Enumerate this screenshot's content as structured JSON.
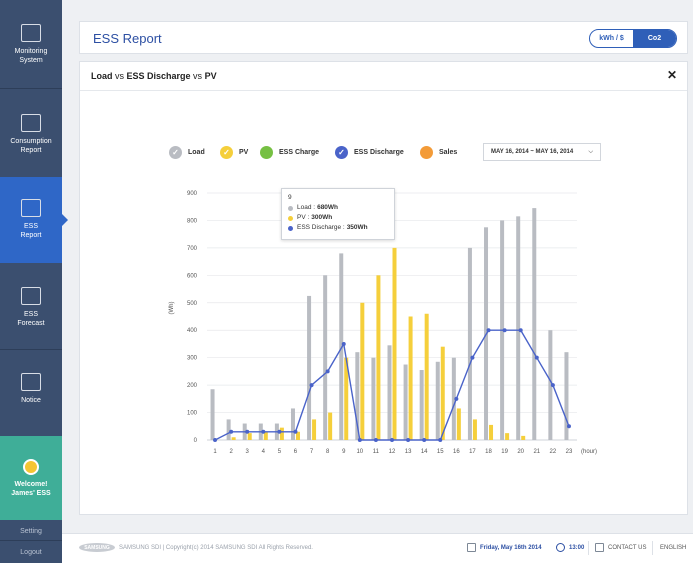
{
  "sidebar": {
    "items": [
      {
        "label": "Monitoring\nSystem",
        "icon": "monitoring-icon"
      },
      {
        "label": "Consumption\nReport",
        "icon": "consumption-report-icon"
      },
      {
        "label": "ESS\nReport",
        "icon": "ess-report-icon"
      },
      {
        "label": "ESS\nForecast",
        "icon": "ess-forecast-icon"
      },
      {
        "label": "Notice",
        "icon": "notice-icon"
      }
    ],
    "welcome": "Welcome!\nJames' ESS",
    "setting": "Setting",
    "logout": "Logout"
  },
  "header": {
    "title": "ESS Report",
    "toggle": [
      "kWh / $",
      "Co2"
    ]
  },
  "panel": {
    "title_parts": [
      "Load",
      " vs ",
      "ESS Discharge",
      " vs ",
      "PV"
    ],
    "close": "✕"
  },
  "legend": [
    {
      "label": "Load",
      "color": "#b9bcc2"
    },
    {
      "label": "PV",
      "color": "#f5cf3b"
    },
    {
      "label": "ESS Charge",
      "color": "#76c043"
    },
    {
      "label": "ESS Discharge",
      "color": "#4a63c9"
    },
    {
      "label": "Sales",
      "color": "#f39b38"
    }
  ],
  "date_range": "MAY 16, 2014 ~ MAY 16, 2014",
  "tooltip": {
    "title": "9",
    "rows": [
      {
        "label": "Load : ",
        "value": "680Wh",
        "color": "#b9bcc2"
      },
      {
        "label": "PV : ",
        "value": "300Wh",
        "color": "#f5cf3b"
      },
      {
        "label": "ESS Discharge : ",
        "value": "350Wh",
        "color": "#4a63c9"
      }
    ]
  },
  "chart_data": {
    "type": "bar",
    "categories": [
      "1",
      "2",
      "3",
      "4",
      "5",
      "6",
      "7",
      "8",
      "9",
      "10",
      "11",
      "12",
      "13",
      "14",
      "15",
      "16",
      "17",
      "18",
      "19",
      "20",
      "21",
      "22",
      "23"
    ],
    "xlabel_unit": "(hour)",
    "ylabel": "(Wh)",
    "ylim": [
      0,
      900
    ],
    "yticks": [
      0,
      100,
      200,
      300,
      400,
      500,
      600,
      700,
      800,
      900
    ],
    "series": [
      {
        "name": "Load",
        "type": "bar",
        "color": "#b9bcc2",
        "values": [
          185,
          75,
          60,
          60,
          60,
          115,
          525,
          600,
          680,
          320,
          300,
          345,
          275,
          255,
          285,
          300,
          700,
          775,
          800,
          815,
          845,
          400,
          320
        ]
      },
      {
        "name": "PV",
        "type": "bar",
        "color": "#f5cf3b",
        "values": [
          0,
          10,
          25,
          30,
          45,
          30,
          75,
          100,
          300,
          500,
          600,
          700,
          450,
          460,
          340,
          115,
          75,
          55,
          25,
          15,
          0,
          0,
          0
        ]
      },
      {
        "name": "ESS Discharge",
        "type": "line",
        "color": "#4a63c9",
        "values": [
          0,
          30,
          30,
          30,
          30,
          30,
          200,
          250,
          350,
          0,
          0,
          0,
          0,
          0,
          0,
          150,
          300,
          400,
          400,
          400,
          300,
          200,
          50
        ]
      }
    ]
  },
  "footer": {
    "brand": "SAMSUNG",
    "copyright": "SAMSUNG SDI  |  Copyright(c) 2014 SAMSUNG SDI All Rights Reserved.",
    "date": "Friday, May 16th 2014",
    "time": "13:00",
    "contact": "CONTACT US",
    "language": "ENGLISH"
  }
}
